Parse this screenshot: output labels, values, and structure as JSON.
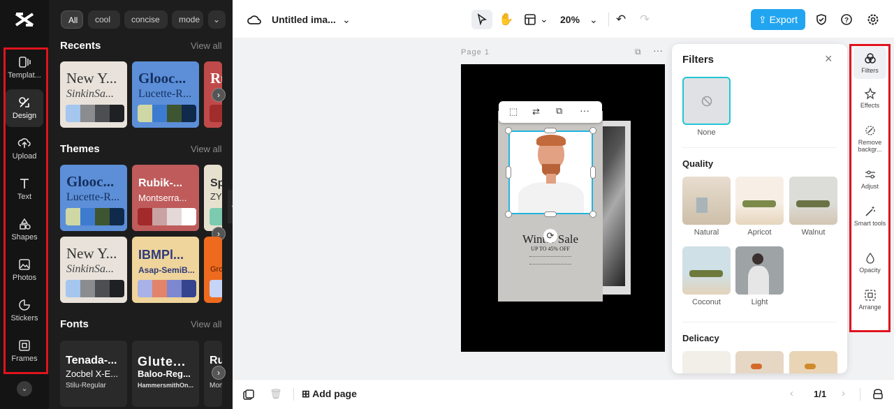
{
  "rail": {
    "items": [
      {
        "label": "Templat..."
      },
      {
        "label": "Design"
      },
      {
        "label": "Upload"
      },
      {
        "label": "Text"
      },
      {
        "label": "Shapes"
      },
      {
        "label": "Photos"
      },
      {
        "label": "Stickers"
      },
      {
        "label": "Frames"
      }
    ]
  },
  "panel": {
    "chips": [
      "All",
      "cool",
      "concise",
      "mode"
    ],
    "recents": {
      "title": "Recents",
      "view_all": "View all"
    },
    "themes": {
      "title": "Themes",
      "view_all": "View all"
    },
    "fonts": {
      "title": "Fonts",
      "view_all": "View all"
    },
    "recent_cards": [
      {
        "t1": "New Y...",
        "t2": "SinkinSa..."
      },
      {
        "t1": "Glooc...",
        "t2": "Lucette-R..."
      },
      {
        "t1": "Ru",
        "t2": ""
      }
    ],
    "theme_cards": [
      {
        "t1": "Glooc...",
        "t2": "Lucette-R..."
      },
      {
        "t1": "Rubik-...",
        "t2": "Montserra..."
      },
      {
        "t1": "Sp",
        "t2": "ZY"
      },
      {
        "t1": "New Y...",
        "t2": "SinkinSa..."
      },
      {
        "t1": "IBMPl...",
        "t2": "Asap-SemiB..."
      },
      {
        "t1": "",
        "t2": "Gro"
      }
    ],
    "font_cards": [
      {
        "f1": "Tenada-...",
        "f2": "Zocbel X-E...",
        "f3": "Stilu-Regular"
      },
      {
        "f1": "Glute...",
        "f2": "Baloo-Reg...",
        "f3": "HammersmithOn..."
      },
      {
        "f1": "Ru",
        "f2": "",
        "f3": "Mon"
      }
    ]
  },
  "topbar": {
    "title": "Untitled ima...",
    "zoom": "20%",
    "export": "Export"
  },
  "canvas": {
    "page_label": "Page 1",
    "poster": {
      "line1": "Winter Sale",
      "line2": "UP TO 45% OFF"
    }
  },
  "bottom": {
    "add_page": "Add page",
    "page_count": "1/1"
  },
  "filters": {
    "title": "Filters",
    "none_label": "None",
    "quality_title": "Quality",
    "delicacy_title": "Delicacy",
    "quality": [
      {
        "label": "Natural"
      },
      {
        "label": "Apricot"
      },
      {
        "label": "Walnut"
      },
      {
        "label": "Coconut"
      },
      {
        "label": "Light"
      }
    ]
  },
  "tools": [
    {
      "label": "Filters"
    },
    {
      "label": "Effects"
    },
    {
      "label": "Remove backgr..."
    },
    {
      "label": "Adjust"
    },
    {
      "label": "Smart tools"
    },
    {
      "label": "Opacity"
    },
    {
      "label": "Arrange"
    }
  ]
}
